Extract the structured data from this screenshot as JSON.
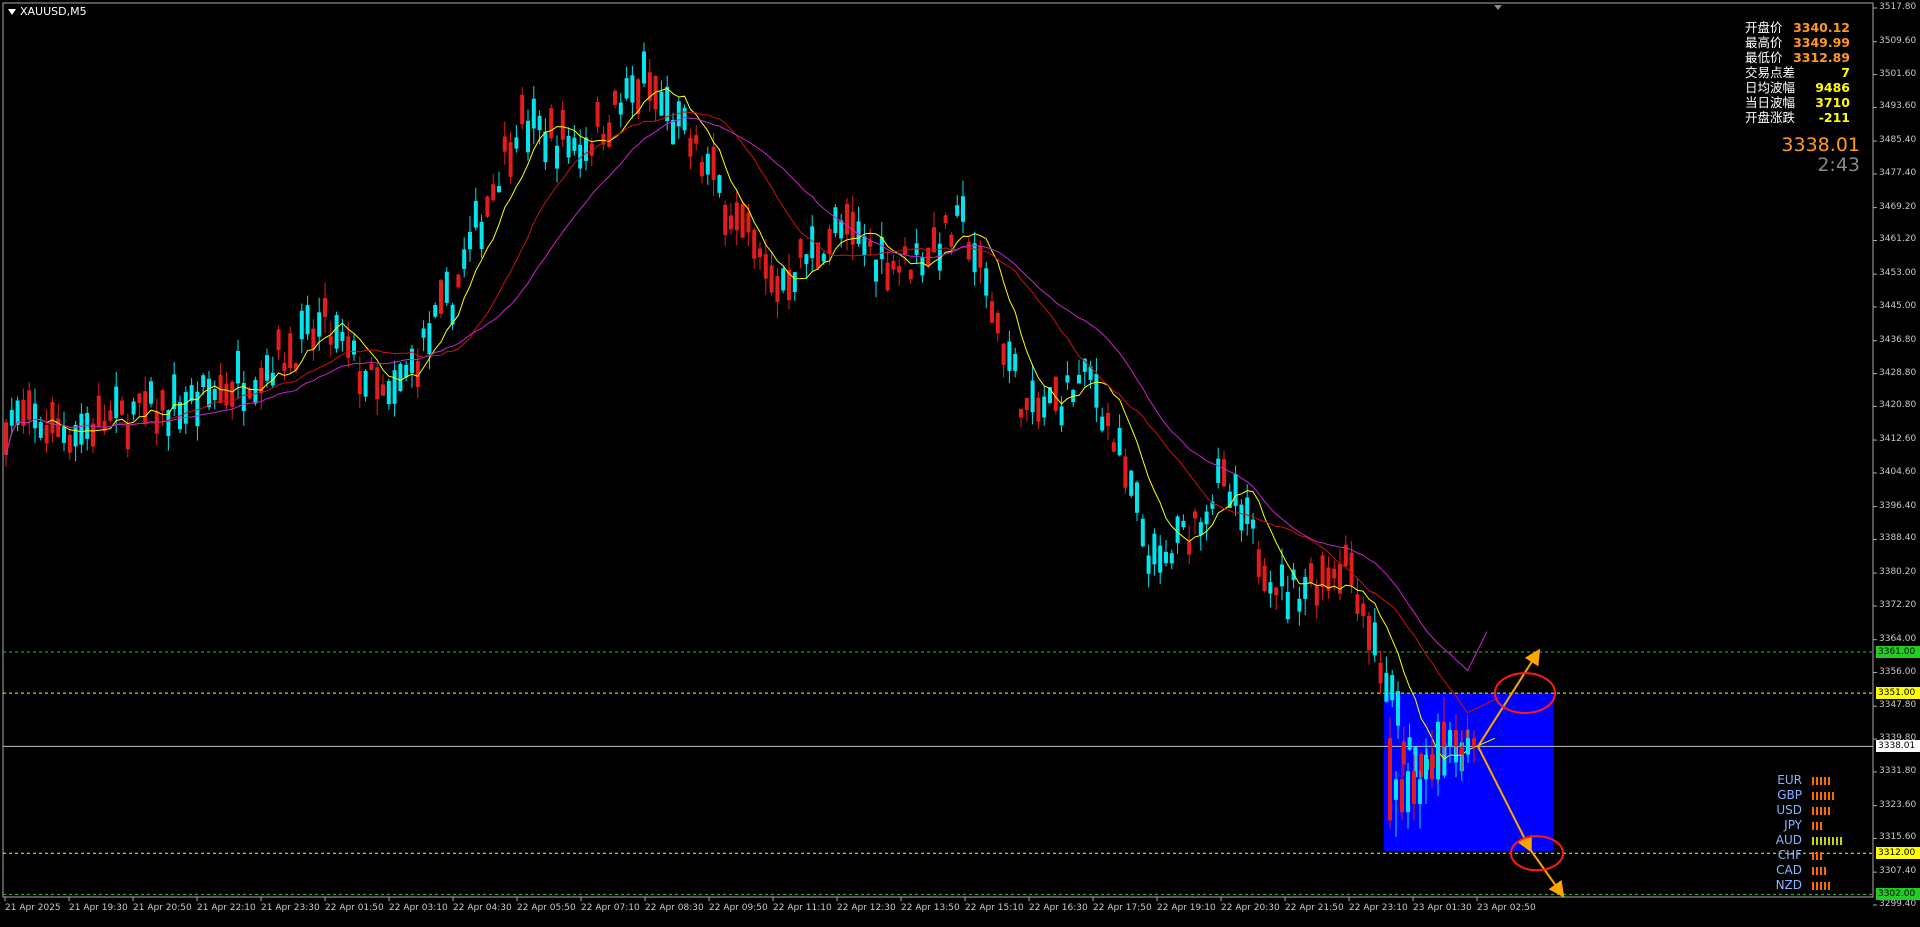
{
  "window": {
    "symbol_title": "XAUUSD,M5"
  },
  "info_panel": [
    {
      "label": "开盘价",
      "value": "3340.12",
      "color": "#ff9a1f"
    },
    {
      "label": "最高价",
      "value": "3349.99",
      "color": "#ff9a1f"
    },
    {
      "label": "最低价",
      "value": "3312.89",
      "color": "#ff9a1f"
    },
    {
      "label": "交易点差",
      "value": "7",
      "color": "#ffff00"
    },
    {
      "label": "日均波幅",
      "value": "9486",
      "color": "#ffff00"
    },
    {
      "label": "当日波幅",
      "value": "3710",
      "color": "#ffff00"
    },
    {
      "label": "开盘涨跌",
      "value": "-211",
      "color": "#ffff00"
    }
  ],
  "current_price": "3338.01",
  "candle_timer": "2:43",
  "price_axis": {
    "ticks": [
      "3517.80",
      "3509.60",
      "3501.60",
      "3493.60",
      "3485.40",
      "3477.40",
      "3469.20",
      "3461.20",
      "3453.00",
      "3445.00",
      "3436.80",
      "3428.80",
      "3420.80",
      "3412.60",
      "3404.60",
      "3396.40",
      "3388.40",
      "3380.20",
      "3372.20",
      "3364.00",
      "3356.00",
      "3347.80",
      "3339.80",
      "3331.80",
      "3323.60",
      "3315.60",
      "3307.40",
      "3299.40"
    ],
    "max": 3517.8,
    "min": 3299.4
  },
  "time_axis": [
    "21 Apr 2025",
    "21 Apr 19:30",
    "21 Apr 20:50",
    "21 Apr 22:10",
    "21 Apr 23:30",
    "22 Apr 01:50",
    "22 Apr 03:10",
    "22 Apr 04:30",
    "22 Apr 05:50",
    "22 Apr 07:10",
    "22 Apr 08:30",
    "22 Apr 09:50",
    "22 Apr 11:10",
    "22 Apr 12:30",
    "22 Apr 13:50",
    "22 Apr 15:10",
    "22 Apr 16:30",
    "22 Apr 17:50",
    "22 Apr 19:10",
    "22 Apr 20:30",
    "22 Apr 21:50",
    "22 Apr 23:10",
    "23 Apr 01:30",
    "23 Apr 02:50"
  ],
  "levels": [
    {
      "price": 3361.0,
      "label": "3361.00",
      "color": "#22cc22",
      "tag_bg": "#22cc22"
    },
    {
      "price": 3351.0,
      "label": "3351.00",
      "color": "#ffff00",
      "tag_bg": "#ffff00"
    },
    {
      "price": 3338.01,
      "label": "3338.01",
      "color": "#c0c0c0",
      "tag_bg": "#ffffff"
    },
    {
      "price": 3312.0,
      "label": "3312.00",
      "color": "#ffff00",
      "tag_bg": "#ffff00"
    },
    {
      "price": 3302.0,
      "label": "3302.00",
      "color": "#22cc22",
      "tag_bg": "#22cc22"
    }
  ],
  "currency_strength": [
    {
      "name": "EUR",
      "bars": 5,
      "color": "#ff6a00"
    },
    {
      "name": "GBP",
      "bars": 6,
      "color": "#ff6a00"
    },
    {
      "name": "USD",
      "bars": 5,
      "color": "#ff6a00"
    },
    {
      "name": "JPY",
      "bars": 3,
      "color": "#ff6a00"
    },
    {
      "name": "AUD",
      "bars": 8,
      "color": "#c8d400"
    },
    {
      "name": "CHF",
      "bars": 3,
      "color": "#ff6a00"
    },
    {
      "name": "CAD",
      "bars": 4,
      "color": "#ff6a00"
    },
    {
      "name": "NZD",
      "bars": 5,
      "color": "#ff6a00"
    }
  ],
  "colors": {
    "bull": "#00e5ee",
    "bear": "#e51c1c",
    "ma_fast": "#ffff00",
    "ma_mid": "#cc1111",
    "ma_slow": "#cc22cc",
    "zone": "#0000ff",
    "arrow": "#ffa500",
    "circle": "#ff1a1a"
  },
  "chart_data": {
    "type": "candlestick",
    "symbol": "XAUUSD",
    "timeframe": "M5",
    "ylim": [
      3299.4,
      3517.8
    ],
    "trend": [
      {
        "x": "21 Apr 2025",
        "y": 3418
      },
      {
        "x": "21 Apr 19:30",
        "y": 3415
      },
      {
        "x": "21 Apr 22:10",
        "y": 3422
      },
      {
        "x": "21 Apr 23:30",
        "y": 3430
      },
      {
        "x": "22 Apr 01:50",
        "y": 3440
      },
      {
        "x": "22 Apr 03:10",
        "y": 3421
      },
      {
        "x": "22 Apr 04:30",
        "y": 3448
      },
      {
        "x": "22 Apr 05:50",
        "y": 3490
      },
      {
        "x": "22 Apr 07:10",
        "y": 3484
      },
      {
        "x": "22 Apr 08:30",
        "y": 3500
      },
      {
        "x": "22 Apr 09:50",
        "y": 3478
      },
      {
        "x": "22 Apr 11:10",
        "y": 3450
      },
      {
        "x": "22 Apr 12:30",
        "y": 3464
      },
      {
        "x": "22 Apr 13:50",
        "y": 3455
      },
      {
        "x": "22 Apr 15:10",
        "y": 3465
      },
      {
        "x": "22 Apr 16:30",
        "y": 3418
      },
      {
        "x": "22 Apr 17:50",
        "y": 3428
      },
      {
        "x": "22 Apr 19:10",
        "y": 3380
      },
      {
        "x": "22 Apr 20:30",
        "y": 3402
      },
      {
        "x": "22 Apr 21:50",
        "y": 3375
      },
      {
        "x": "22 Apr 23:10",
        "y": 3384
      },
      {
        "x": "23 Apr 01:30",
        "y": 3332
      },
      {
        "x": "23 Apr 02:50",
        "y": 3338
      }
    ]
  }
}
